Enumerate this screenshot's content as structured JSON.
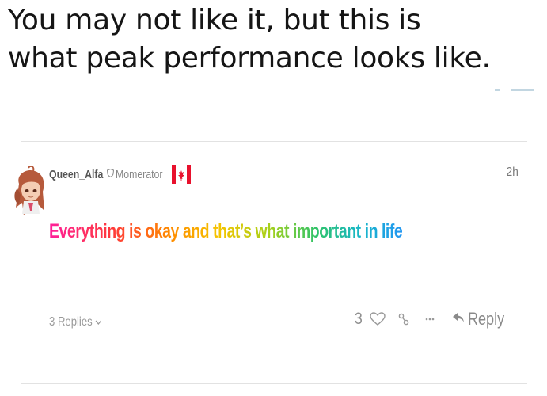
{
  "caption": {
    "line1": "You may not like it, but this is",
    "line2": "what peak performance looks like."
  },
  "comment": {
    "username": "Queen_Alfa",
    "role_icon": "shield-icon",
    "role": "Momerator",
    "flag": "canada-flag",
    "timestamp": "2h",
    "text": "Everything is okay and that’s what important in life",
    "replies_label": "3 Replies",
    "like_count": "3",
    "reply_label": "Reply"
  },
  "colors": {
    "gradient": [
      "#ff1f9a",
      "#ff3a3a",
      "#ff8a00",
      "#f5c400",
      "#a9d11a",
      "#2ec36b",
      "#18b7c8",
      "#2196f3"
    ],
    "meta_gray": "#8f8f8f",
    "flag_red": "#e8112d"
  }
}
